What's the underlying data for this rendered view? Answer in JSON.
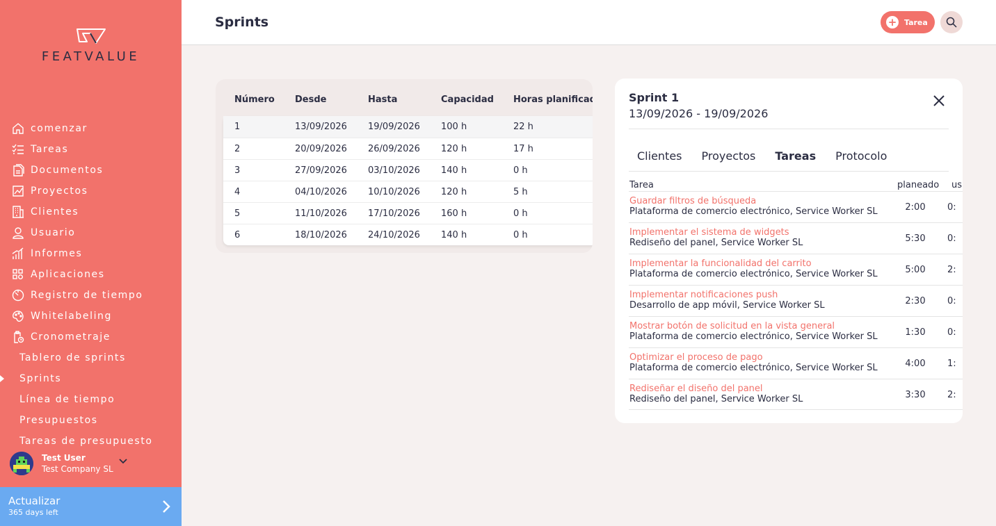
{
  "brand": {
    "name": "FEATVALUE"
  },
  "sidebar": {
    "items": [
      {
        "label": "comenzar",
        "icon": "home-icon"
      },
      {
        "label": "Tareas",
        "icon": "checklist-icon"
      },
      {
        "label": "Documentos",
        "icon": "documents-icon"
      },
      {
        "label": "Proyectos",
        "icon": "chart-icon"
      },
      {
        "label": "Clientes",
        "icon": "building-icon"
      },
      {
        "label": "Usuario",
        "icon": "user-icon"
      },
      {
        "label": "Informes",
        "icon": "bars-icon"
      },
      {
        "label": "Aplicaciones",
        "icon": "apps-icon"
      },
      {
        "label": "Registro de tiempo",
        "icon": "timer-icon"
      },
      {
        "label": "Whitelabeling",
        "icon": "palette-icon"
      },
      {
        "label": "Cronometraje",
        "icon": "clipboard-clock-icon"
      }
    ],
    "subitems": [
      {
        "label": "Tablero de sprints"
      },
      {
        "label": "Sprints",
        "active": true
      },
      {
        "label": "Línea de tiempo"
      },
      {
        "label": "Presupuestos"
      },
      {
        "label": "Tareas de presupuesto"
      }
    ],
    "user": {
      "name": "Test User",
      "company": "Test Company SL"
    },
    "upgrade": {
      "title": "Actualizar",
      "subtitle": "365 days left"
    }
  },
  "header": {
    "title": "Sprints",
    "task_button": "Tarea"
  },
  "sprint_table": {
    "columns": [
      "Número",
      "Desde",
      "Hasta",
      "Capacidad",
      "Horas planificadas"
    ],
    "rows": [
      [
        "1",
        "13/09/2026",
        "19/09/2026",
        "100 h",
        "22 h"
      ],
      [
        "2",
        "20/09/2026",
        "26/09/2026",
        "120 h",
        "17 h"
      ],
      [
        "3",
        "27/09/2026",
        "03/10/2026",
        "140 h",
        "0 h"
      ],
      [
        "4",
        "04/10/2026",
        "10/10/2026",
        "120 h",
        "5 h"
      ],
      [
        "5",
        "11/10/2026",
        "17/10/2026",
        "160 h",
        "0 h"
      ],
      [
        "6",
        "18/10/2026",
        "24/10/2026",
        "140 h",
        "0 h"
      ]
    ]
  },
  "detail": {
    "title": "Sprint 1",
    "dates": "13/09/2026 - 19/09/2026",
    "tabs": [
      {
        "label": "Clientes"
      },
      {
        "label": "Proyectos"
      },
      {
        "label": "Tareas",
        "active": true
      },
      {
        "label": "Protocolo"
      }
    ],
    "columns": [
      "Tarea",
      "planeado",
      "us"
    ],
    "tasks": [
      {
        "name": "Guardar filtros de búsqueda",
        "project": "Plataforma de comercio electrónico, Service Worker SL",
        "planned": "2:00",
        "used": "0:"
      },
      {
        "name": "Implementar el sistema de widgets",
        "project": "Rediseño del panel, Service Worker SL",
        "planned": "5:30",
        "used": "0:"
      },
      {
        "name": "Implementar la funcionalidad del carrito",
        "project": "Plataforma de comercio electrónico, Service Worker SL",
        "planned": "5:00",
        "used": "2:"
      },
      {
        "name": "Implementar notificaciones push",
        "project": "Desarrollo de app móvil, Service Worker SL",
        "planned": "2:30",
        "used": "0:"
      },
      {
        "name": "Mostrar botón de solicitud en la vista general",
        "project": "Plataforma de comercio electrónico, Service Worker SL",
        "planned": "1:30",
        "used": "0:"
      },
      {
        "name": "Optimizar el proceso de pago",
        "project": "Plataforma de comercio electrónico, Service Worker SL",
        "planned": "4:00",
        "used": "1:"
      },
      {
        "name": "Rediseñar el diseño del panel",
        "project": "Rediseño del panel, Service Worker SL",
        "planned": "3:30",
        "used": "2:"
      }
    ]
  },
  "colors": {
    "accent": "#f2726b",
    "upgrade": "#6aaaf1",
    "text": "#2b2d42",
    "background": "#f6f1f0"
  }
}
